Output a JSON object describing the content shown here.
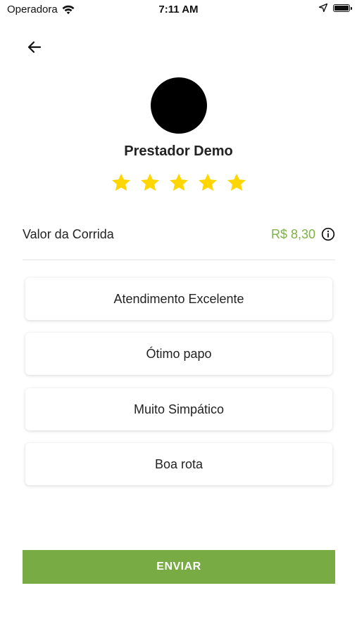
{
  "status_bar": {
    "carrier": "Operadora",
    "time": "7:11 AM",
    "icons": [
      "wifi-icon",
      "location-arrow-icon",
      "battery-icon"
    ]
  },
  "header": {
    "back_icon": "arrow-left-icon"
  },
  "provider": {
    "name": "Prestador Demo",
    "rating": 5,
    "max_rating": 5,
    "star_color": "#FFD600"
  },
  "fare": {
    "label": "Valor da Corrida",
    "value": "R$ 8,30",
    "value_color": "#7CB342",
    "info_icon": "info-icon"
  },
  "options": [
    {
      "label": "Atendimento Excelente"
    },
    {
      "label": "Ótimo papo"
    },
    {
      "label": "Muito Simpático"
    },
    {
      "label": "Boa rota"
    }
  ],
  "submit": {
    "label": "ENVIAR",
    "color": "#78AB43"
  }
}
